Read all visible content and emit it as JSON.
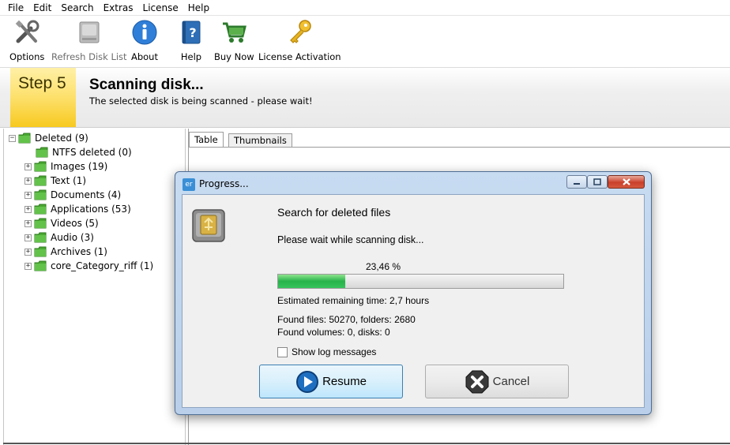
{
  "menu": [
    "File",
    "Edit",
    "Search",
    "Extras",
    "License",
    "Help"
  ],
  "toolbar": {
    "options": "Options",
    "refresh": "Refresh Disk List",
    "about": "About",
    "help": "Help",
    "buy": "Buy Now",
    "license": "License Activation"
  },
  "banner": {
    "step": "Step 5",
    "title": "Scanning disk...",
    "subtitle": "The selected disk is being scanned - please wait!"
  },
  "tree": {
    "root": "Deleted (9)",
    "children": [
      "NTFS deleted (0)",
      "Images (19)",
      "Text (1)",
      "Documents (4)",
      "Applications (53)",
      "Videos (5)",
      "Audio (3)",
      "Archives (1)",
      "core_Category_riff (1)"
    ]
  },
  "tabs": [
    "Table",
    "Thumbnails"
  ],
  "dialog": {
    "icon_text": "er",
    "title": "Progress...",
    "heading": "Search for deleted files",
    "wait": "Please wait while scanning disk...",
    "percent_label": "23,46 %",
    "progress_fraction": 0.2346,
    "remaining": "Estimated remaining time: 2,7 hours",
    "found_files": "Found files: 50270, folders: 2680",
    "found_volumes": "Found volumes: 0, disks: 0",
    "show_log": "Show log messages",
    "show_log_checked": false,
    "resume": "Resume",
    "cancel": "Cancel"
  },
  "colors": {
    "step_yellow": "#f7c91f",
    "progress_green": "#27b34a",
    "dialog_frame": "#b9cfea",
    "folder_green": "#4aa832"
  }
}
